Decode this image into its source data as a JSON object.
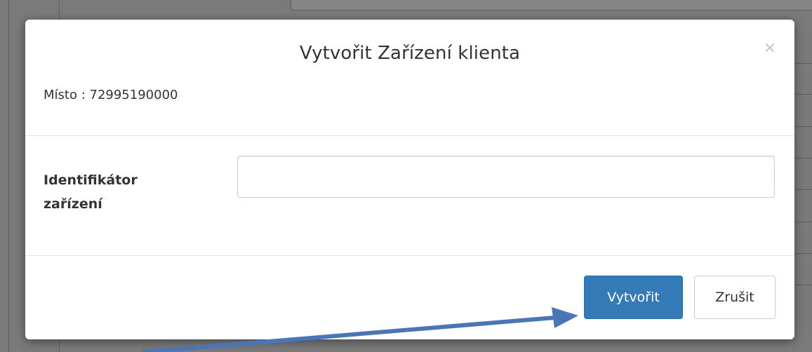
{
  "dialog": {
    "title": "Vytvořit Zařízení klienta",
    "close_symbol": "×",
    "place_label": "Místo",
    "place_separator": " : ",
    "place_value": "72995190000"
  },
  "form": {
    "device_id_label": "Identifikátor zařízení",
    "device_id_value": "",
    "device_id_placeholder": ""
  },
  "footer": {
    "create_label": "Vytvořit",
    "cancel_label": "Zrušit"
  },
  "annotation": {
    "arrow_color": "#4a76b8"
  },
  "colors": {
    "primary": "#337ab7",
    "overlay": "#7a7a7a"
  }
}
